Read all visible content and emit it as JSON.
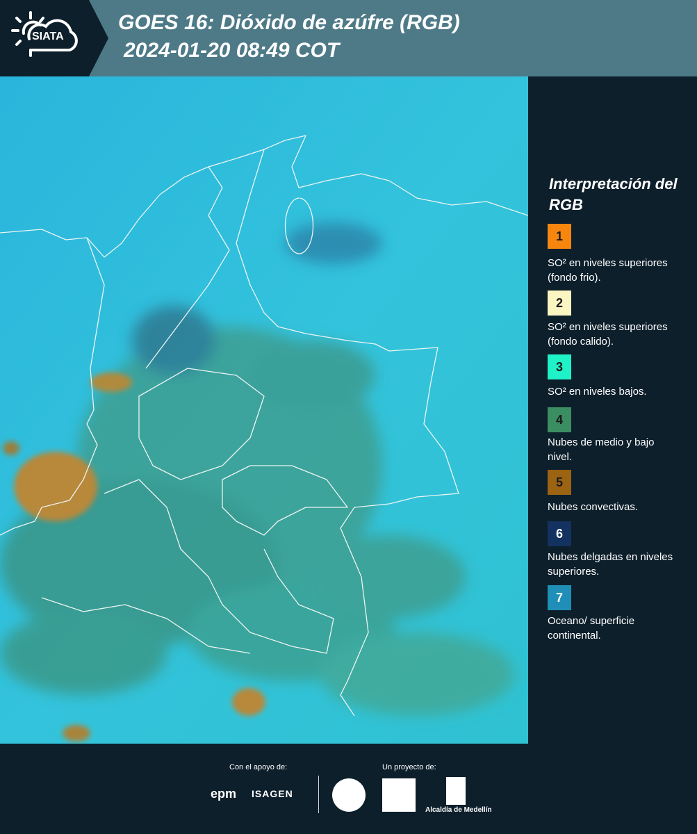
{
  "header": {
    "logo_text": "SIATA",
    "title_line1": "GOES 16: Dióxido de azúfre (RGB)",
    "title_line2": "2024-01-20 08:49 COT"
  },
  "legend": {
    "title": "Interpretación del RGB",
    "items": [
      {
        "number": "1",
        "color": "#f7860f",
        "text": "SO² en niveles superiores (fondo frio)."
      },
      {
        "number": "2",
        "color": "#fbf5c1",
        "text": "SO² en niveles superiores (fondo calido)."
      },
      {
        "number": "3",
        "color": "#1ff2c6",
        "text": "SO² en niveles bajos."
      },
      {
        "number": "4",
        "color": "#3b8e61",
        "text": "Nubes de medio y bajo nivel."
      },
      {
        "number": "5",
        "color": "#9b6312",
        "text": "Nubes convectivas."
      },
      {
        "number": "6",
        "color": "#143260",
        "text": "Nubes delgadas en niveles superiores."
      },
      {
        "number": "7",
        "color": "#1f8fb8",
        "text": "Oceano/ superficie continental."
      }
    ]
  },
  "footer": {
    "support_label": "Con el apoyo de:",
    "project_label": "Un proyecto de:",
    "epm": "epm",
    "isagen": "ISAGEN",
    "alcaldia": "Alcaldía de Medellín"
  }
}
